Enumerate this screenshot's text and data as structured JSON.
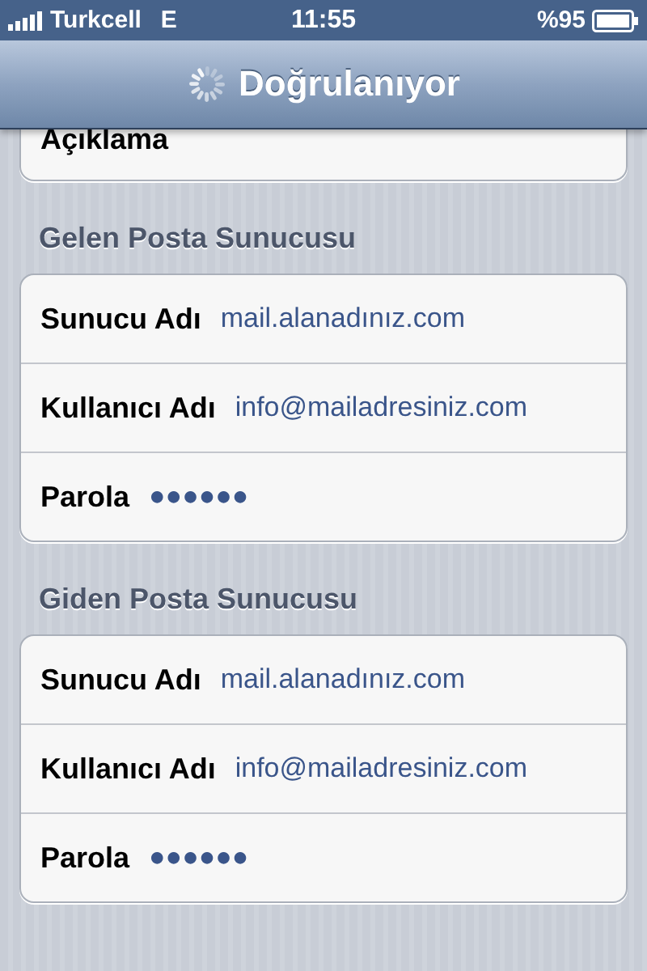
{
  "status_bar": {
    "carrier": "Turkcell",
    "network": "E",
    "time": "11:55",
    "battery": "%95"
  },
  "nav_bar": {
    "title": "Doğrulanıyor",
    "loading": true
  },
  "top_group": {
    "rows": [
      {
        "label": "Açıklama"
      }
    ]
  },
  "sections": [
    {
      "header": "Gelen Posta Sunucusu",
      "rows": [
        {
          "label": "Sunucu Adı",
          "value": "mail.alanadınız.com"
        },
        {
          "label": "Kullanıcı Adı",
          "value": "info@mailadresiniz.com"
        },
        {
          "label": "Parola",
          "value": "●●●●●●"
        }
      ]
    },
    {
      "header": "Giden Posta Sunucusu",
      "rows": [
        {
          "label": "Sunucu Adı",
          "value": "mail.alanadınız.com"
        },
        {
          "label": "Kullanıcı Adı",
          "value": "info@mailadresiniz.com"
        },
        {
          "label": "Parola",
          "value": "●●●●●●"
        }
      ]
    }
  ]
}
